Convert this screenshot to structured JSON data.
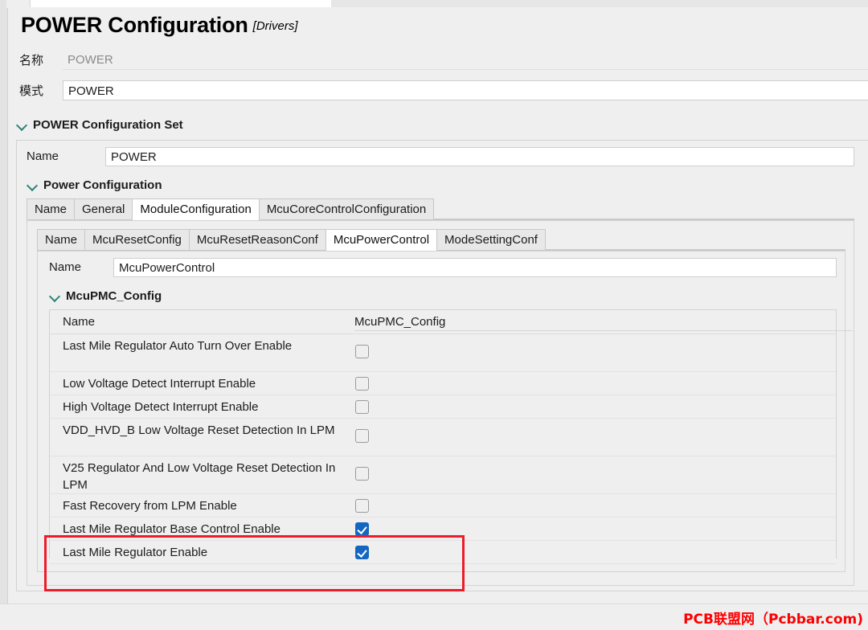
{
  "window": {
    "title": "POWER Configuration",
    "title_suffix": "[Drivers]"
  },
  "header_fields": [
    {
      "label": "名称",
      "value": "POWER",
      "readonly": true
    },
    {
      "label": "模式",
      "value": "POWER",
      "readonly": false
    }
  ],
  "groups": {
    "power_configuration_set": {
      "title": "POWER Configuration Set",
      "name_label": "Name",
      "name_value": "POWER"
    },
    "power_configuration": {
      "title": "Power Configuration"
    },
    "mcu_pmc_config": {
      "title": "McuPMC_Config",
      "name_label": "Name",
      "name_value": "McuPMC_Config"
    }
  },
  "tabs_level1": [
    {
      "label": "Name",
      "active": false
    },
    {
      "label": "General",
      "active": false
    },
    {
      "label": "ModuleConfiguration",
      "active": true
    },
    {
      "label": "McuCoreControlConfiguration",
      "active": false
    }
  ],
  "tabs_level2": [
    {
      "label": "Name",
      "active": false
    },
    {
      "label": "McuResetConfig",
      "active": false
    },
    {
      "label": "McuResetReasonConf",
      "active": false
    },
    {
      "label": "McuPowerControl",
      "active": true
    },
    {
      "label": "ModeSettingConf",
      "active": false
    }
  ],
  "mcu_power_control": {
    "name_label": "Name",
    "name_value": "McuPowerControl"
  },
  "properties": [
    {
      "label": "Last Mile Regulator Auto Turn Over Enable",
      "checked": false,
      "highlighted": false
    },
    {
      "label": "Low Voltage Detect Interrupt Enable",
      "checked": false,
      "highlighted": false
    },
    {
      "label": "High Voltage Detect Interrupt Enable",
      "checked": false,
      "highlighted": false
    },
    {
      "label": "VDD_HVD_B Low Voltage Reset Detection In LPM",
      "checked": false,
      "highlighted": false
    },
    {
      "label": "V25 Regulator And Low Voltage Reset Detection In LPM",
      "checked": false,
      "highlighted": false
    },
    {
      "label": "Fast Recovery from LPM Enable",
      "checked": false,
      "highlighted": false
    },
    {
      "label": "Last Mile Regulator Base Control Enable",
      "checked": true,
      "highlighted": true
    },
    {
      "label": "Last Mile Regulator Enable",
      "checked": true,
      "highlighted": true
    }
  ],
  "watermark": {
    "text": "PCB联盟网（Pcbbar.com)"
  },
  "colors": {
    "accent_chevron": "#2c8577",
    "checkbox_checked": "#1467c0",
    "annotation": "#ee1c28",
    "watermark": "#fd0000"
  },
  "icons": {
    "expander": "chevron-down-icon"
  }
}
